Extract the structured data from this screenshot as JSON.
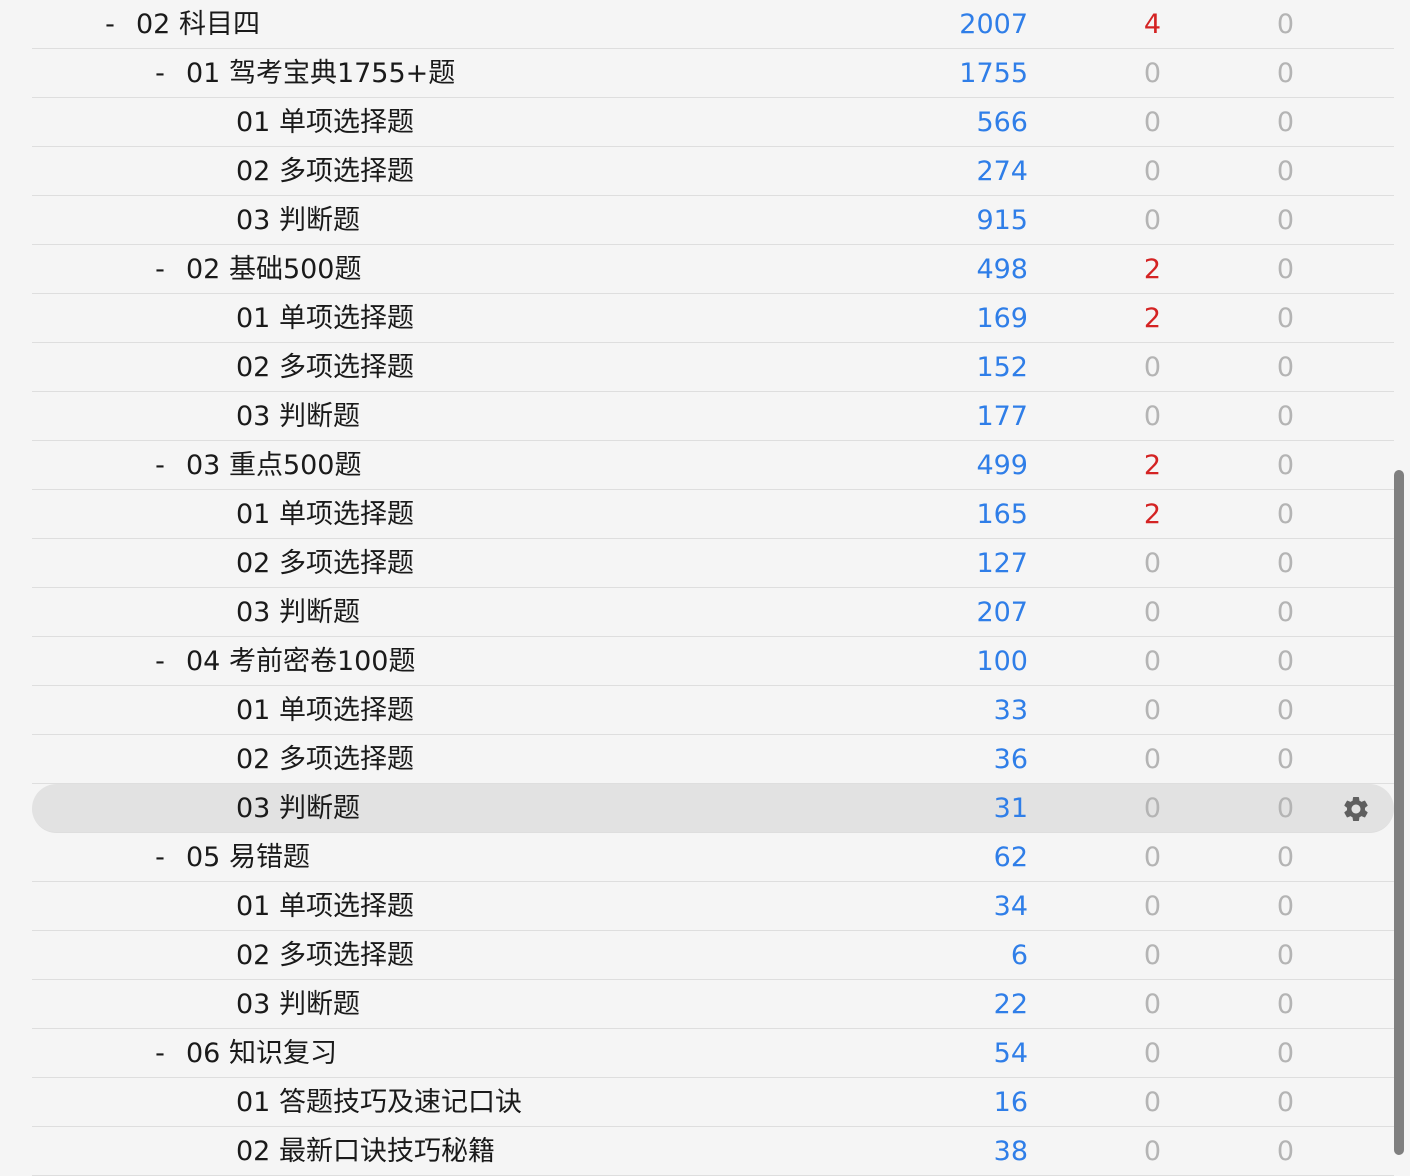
{
  "colors": {
    "new": "#2f7ee8",
    "learn": "#d42323",
    "review": "#aaaaaa",
    "zero": "#b4b4b4"
  },
  "icons": {
    "options": "gear-icon",
    "collapse": "minus-toggle"
  },
  "decks": [
    {
      "name": "02 科目四",
      "level": 0,
      "toggle": "-",
      "new": "2007",
      "learn": "4",
      "review": "0"
    },
    {
      "name": "01 驾考宝典1755+题",
      "level": 1,
      "toggle": "-",
      "new": "1755",
      "learn": "0",
      "review": "0"
    },
    {
      "name": "01 单项选择题",
      "level": 2,
      "toggle": "",
      "new": "566",
      "learn": "0",
      "review": "0"
    },
    {
      "name": "02 多项选择题",
      "level": 2,
      "toggle": "",
      "new": "274",
      "learn": "0",
      "review": "0"
    },
    {
      "name": "03 判断题",
      "level": 2,
      "toggle": "",
      "new": "915",
      "learn": "0",
      "review": "0"
    },
    {
      "name": "02 基础500题",
      "level": 1,
      "toggle": "-",
      "new": "498",
      "learn": "2",
      "review": "0"
    },
    {
      "name": "01 单项选择题",
      "level": 2,
      "toggle": "",
      "new": "169",
      "learn": "2",
      "review": "0"
    },
    {
      "name": "02 多项选择题",
      "level": 2,
      "toggle": "",
      "new": "152",
      "learn": "0",
      "review": "0"
    },
    {
      "name": "03 判断题",
      "level": 2,
      "toggle": "",
      "new": "177",
      "learn": "0",
      "review": "0"
    },
    {
      "name": "03 重点500题",
      "level": 1,
      "toggle": "-",
      "new": "499",
      "learn": "2",
      "review": "0"
    },
    {
      "name": "01 单项选择题",
      "level": 2,
      "toggle": "",
      "new": "165",
      "learn": "2",
      "review": "0"
    },
    {
      "name": "02 多项选择题",
      "level": 2,
      "toggle": "",
      "new": "127",
      "learn": "0",
      "review": "0"
    },
    {
      "name": "03 判断题",
      "level": 2,
      "toggle": "",
      "new": "207",
      "learn": "0",
      "review": "0"
    },
    {
      "name": "04 考前密卷100题",
      "level": 1,
      "toggle": "-",
      "new": "100",
      "learn": "0",
      "review": "0"
    },
    {
      "name": "01 单项选择题",
      "level": 2,
      "toggle": "",
      "new": "33",
      "learn": "0",
      "review": "0"
    },
    {
      "name": "02 多项选择题",
      "level": 2,
      "toggle": "",
      "new": "36",
      "learn": "0",
      "review": "0"
    },
    {
      "name": "03 判断题",
      "level": 2,
      "toggle": "",
      "new": "31",
      "learn": "0",
      "review": "0",
      "selected": true
    },
    {
      "name": "05 易错题",
      "level": 1,
      "toggle": "-",
      "new": "62",
      "learn": "0",
      "review": "0"
    },
    {
      "name": "01 单项选择题",
      "level": 2,
      "toggle": "",
      "new": "34",
      "learn": "0",
      "review": "0"
    },
    {
      "name": "02 多项选择题",
      "level": 2,
      "toggle": "",
      "new": "6",
      "learn": "0",
      "review": "0"
    },
    {
      "name": "03 判断题",
      "level": 2,
      "toggle": "",
      "new": "22",
      "learn": "0",
      "review": "0"
    },
    {
      "name": "06 知识复习",
      "level": 1,
      "toggle": "-",
      "new": "54",
      "learn": "0",
      "review": "0"
    },
    {
      "name": "01 答题技巧及速记口诀",
      "level": 2,
      "toggle": "",
      "new": "16",
      "learn": "0",
      "review": "0"
    },
    {
      "name": "02 最新口诀技巧秘籍",
      "level": 2,
      "toggle": "",
      "new": "38",
      "learn": "0",
      "review": "0"
    }
  ]
}
